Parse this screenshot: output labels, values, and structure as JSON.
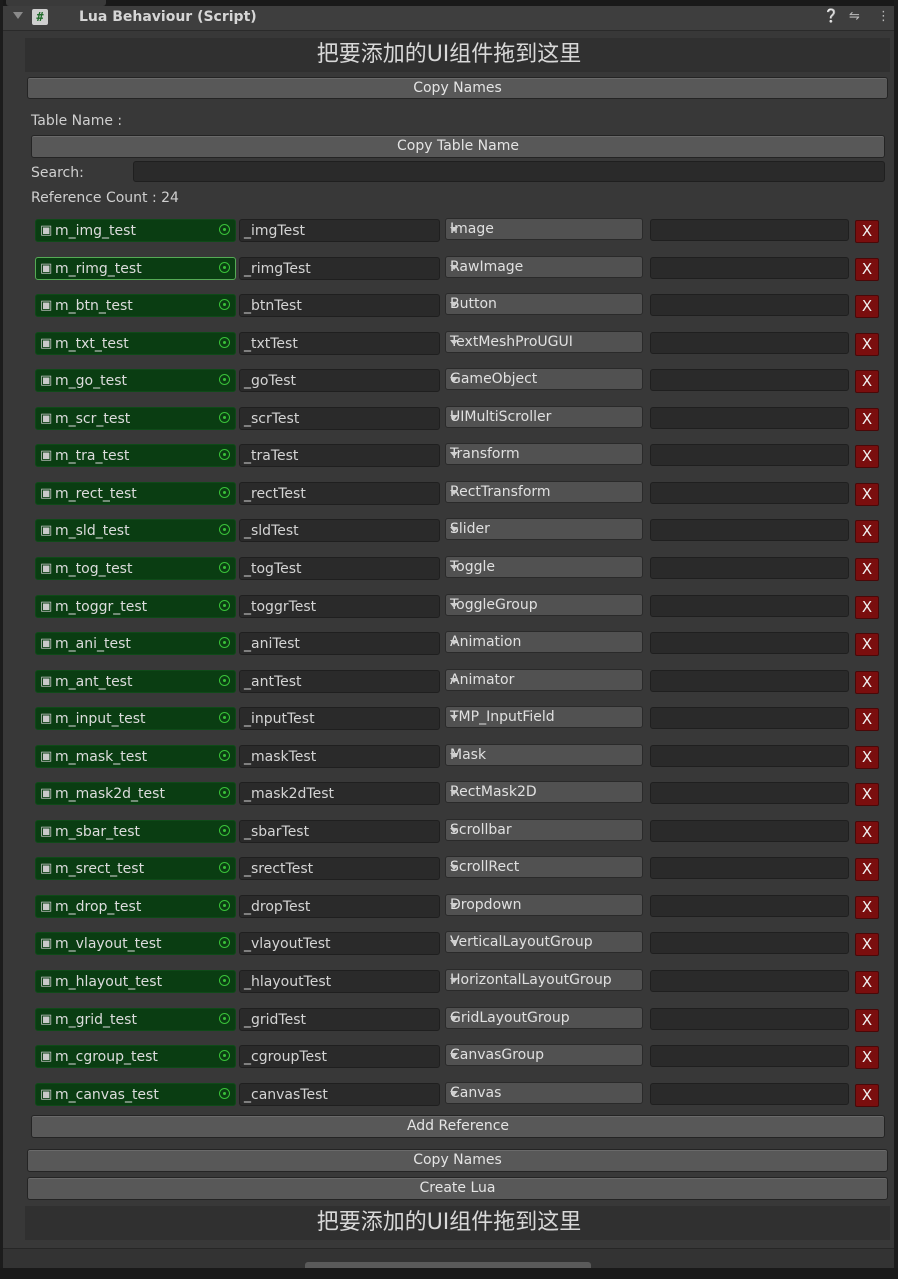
{
  "header": {
    "title": "Lua Behaviour (Script)",
    "script_icon": "#",
    "icons": [
      "help-icon",
      "preset-icon",
      "more-menu-icon"
    ]
  },
  "top_banner": "把要添加的UI组件拖到这里",
  "bottom_banner": "把要添加的UI组件拖到这里",
  "buttons": {
    "copy_names_top": "Copy Names",
    "copy_table_name": "Copy Table Name",
    "add_reference": "Add Reference",
    "copy_names_bottom": "Copy Names",
    "create_lua": "Create Lua"
  },
  "labels": {
    "table_name": "Table Name :",
    "search": "Search:",
    "reference_count": "Reference Count : 24"
  },
  "search": {
    "value": ""
  },
  "delete_label": "X",
  "references": [
    {
      "object": "m_img_test",
      "name": "_imgTest",
      "type": "Image"
    },
    {
      "object": "m_rimg_test",
      "name": "_rimgTest",
      "type": "RawImage",
      "selected": true
    },
    {
      "object": "m_btn_test",
      "name": "_btnTest",
      "type": "Button"
    },
    {
      "object": "m_txt_test",
      "name": "_txtTest",
      "type": "TextMeshProUGUI"
    },
    {
      "object": "m_go_test",
      "name": "_goTest",
      "type": "GameObject"
    },
    {
      "object": "m_scr_test",
      "name": "_scrTest",
      "type": "UIMultiScroller"
    },
    {
      "object": "m_tra_test",
      "name": "_traTest",
      "type": "Transform"
    },
    {
      "object": "m_rect_test",
      "name": "_rectTest",
      "type": "RectTransform"
    },
    {
      "object": "m_sld_test",
      "name": "_sldTest",
      "type": "Slider"
    },
    {
      "object": "m_tog_test",
      "name": "_togTest",
      "type": "Toggle"
    },
    {
      "object": "m_toggr_test",
      "name": "_toggrTest",
      "type": "ToggleGroup"
    },
    {
      "object": "m_ani_test",
      "name": "_aniTest",
      "type": "Animation"
    },
    {
      "object": "m_ant_test",
      "name": "_antTest",
      "type": "Animator"
    },
    {
      "object": "m_input_test",
      "name": "_inputTest",
      "type": "TMP_InputField"
    },
    {
      "object": "m_mask_test",
      "name": "_maskTest",
      "type": "Mask"
    },
    {
      "object": "m_mask2d_test",
      "name": "_mask2dTest",
      "type": "RectMask2D"
    },
    {
      "object": "m_sbar_test",
      "name": "_sbarTest",
      "type": "Scrollbar"
    },
    {
      "object": "m_srect_test",
      "name": "_srectTest",
      "type": "ScrollRect"
    },
    {
      "object": "m_drop_test",
      "name": "_dropTest",
      "type": "Dropdown"
    },
    {
      "object": "m_vlayout_test",
      "name": "_vlayoutTest",
      "type": "VerticalLayoutGroup"
    },
    {
      "object": "m_hlayout_test",
      "name": "_hlayoutTest",
      "type": "HorizontalLayoutGroup"
    },
    {
      "object": "m_grid_test",
      "name": "_gridTest",
      "type": "GridLayoutGroup"
    },
    {
      "object": "m_cgroup_test",
      "name": "_cgroupTest",
      "type": "CanvasGroup"
    },
    {
      "object": "m_canvas_test",
      "name": "_canvasTest",
      "type": "Canvas"
    }
  ]
}
